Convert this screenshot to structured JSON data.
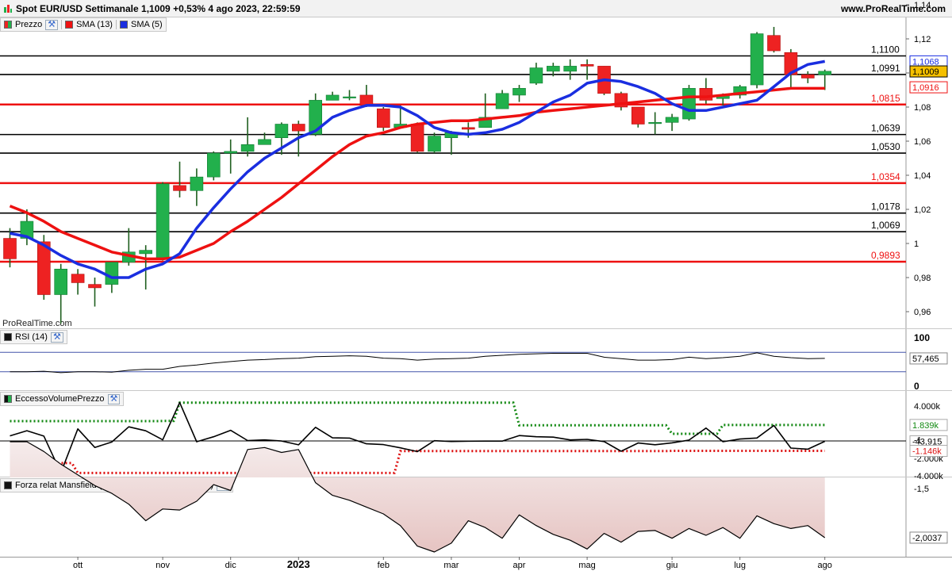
{
  "header": {
    "title": "Spot EUR/USD Settimanale 1,1009 +0,53% 4 ago 2023, 22:59:59",
    "site": "www.ProRealTime.com",
    "watermark": "ProRealTime.com"
  },
  "legend": {
    "price": "Prezzo",
    "sma13": "SMA (13)",
    "sma5": "SMA (5)",
    "rsi": "RSI (14)",
    "pve": "EccessoVolumePrezzo",
    "mansfield": "Forza relat Mansfield (FTSE MIB40 Index) (200 10)"
  },
  "colors": {
    "up": "#22b04c",
    "down": "#ee2222",
    "sma13": "#ee1111",
    "sma5": "#1a2ee0",
    "support": "#000000",
    "key_level": "#ee1111",
    "band_upper": "#118811",
    "band_lower": "#dd1111",
    "mansfield_fill": "#e6c4c2"
  },
  "chart_data": [
    {
      "type": "candlestick",
      "panel": "price",
      "title": "Spot EUR/USD Settimanale",
      "ylim": [
        0.94,
        1.145
      ],
      "y_ticks": [
        {
          "v": 0.96,
          "label": "0,96"
        },
        {
          "v": 0.98,
          "label": "0,98"
        },
        {
          "v": 1.0,
          "label": "1"
        },
        {
          "v": 1.02,
          "label": "1,02"
        },
        {
          "v": 1.04,
          "label": "1,04"
        },
        {
          "v": 1.06,
          "label": "1,06"
        },
        {
          "v": 1.08,
          "label": "1,08"
        },
        {
          "v": 1.1,
          "label": "1,10"
        },
        {
          "v": 1.12,
          "label": "1,12"
        },
        {
          "v": 1.14,
          "label": "1,14"
        }
      ],
      "x_labels": [
        {
          "i": 4,
          "label": "ott"
        },
        {
          "i": 9,
          "label": "nov"
        },
        {
          "i": 13,
          "label": "dic"
        },
        {
          "i": 17,
          "label": "2023"
        },
        {
          "i": 22,
          "label": "feb"
        },
        {
          "i": 26,
          "label": "mar"
        },
        {
          "i": 30,
          "label": "apr"
        },
        {
          "i": 34,
          "label": "mag"
        },
        {
          "i": 39,
          "label": "giu"
        },
        {
          "i": 43,
          "label": "lug"
        },
        {
          "i": 48,
          "label": "ago"
        }
      ],
      "candles": [
        [
          1.003,
          0.991,
          1.009,
          0.986
        ],
        [
          1.003,
          1.013,
          1.02,
          0.999
        ],
        [
          1.001,
          0.97,
          1.005,
          0.967
        ],
        [
          0.97,
          0.985,
          0.988,
          0.953
        ],
        [
          0.982,
          0.977,
          0.985,
          0.97
        ],
        [
          0.976,
          0.974,
          0.98,
          0.963
        ],
        [
          0.976,
          0.989,
          0.989,
          0.971
        ],
        [
          0.989,
          0.995,
          1.009,
          0.987
        ],
        [
          0.994,
          0.996,
          0.999,
          0.973
        ],
        [
          0.991,
          1.035,
          1.036,
          0.99
        ],
        [
          1.034,
          1.031,
          1.048,
          1.027
        ],
        [
          1.031,
          1.039,
          1.044,
          1.022
        ],
        [
          1.039,
          1.053,
          1.054,
          1.037
        ],
        [
          1.053,
          1.054,
          1.061,
          1.041
        ],
        [
          1.054,
          1.058,
          1.074,
          1.051
        ],
        [
          1.058,
          1.061,
          1.065,
          1.058
        ],
        [
          1.062,
          1.07,
          1.071,
          1.052
        ],
        [
          1.07,
          1.066,
          1.072,
          1.051
        ],
        [
          1.064,
          1.084,
          1.088,
          1.063
        ],
        [
          1.084,
          1.087,
          1.089,
          1.084
        ],
        [
          1.086,
          1.086,
          1.09,
          1.084
        ],
        [
          1.087,
          1.081,
          1.093,
          1.08
        ],
        [
          1.079,
          1.068,
          1.08,
          1.066
        ],
        [
          1.068,
          1.07,
          1.081,
          1.068
        ],
        [
          1.07,
          1.054,
          1.071,
          1.053
        ],
        [
          1.054,
          1.063,
          1.065,
          1.053
        ],
        [
          1.062,
          1.065,
          1.066,
          1.052
        ],
        [
          1.068,
          1.067,
          1.071,
          1.062
        ],
        [
          1.068,
          1.074,
          1.088,
          1.068
        ],
        [
          1.079,
          1.088,
          1.09,
          1.079
        ],
        [
          1.087,
          1.091,
          1.093,
          1.083
        ],
        [
          1.094,
          1.103,
          1.106,
          1.093
        ],
        [
          1.101,
          1.104,
          1.106,
          1.098
        ],
        [
          1.101,
          1.104,
          1.108,
          1.096
        ],
        [
          1.105,
          1.104,
          1.108,
          1.096
        ],
        [
          1.104,
          1.088,
          1.104,
          1.087
        ],
        [
          1.088,
          1.08,
          1.089,
          1.078
        ],
        [
          1.08,
          1.07,
          1.08,
          1.068
        ],
        [
          1.071,
          1.071,
          1.077,
          1.064
        ],
        [
          1.071,
          1.074,
          1.076,
          1.066
        ],
        [
          1.073,
          1.091,
          1.093,
          1.072
        ],
        [
          1.091,
          1.084,
          1.097,
          1.082
        ],
        [
          1.085,
          1.087,
          1.088,
          1.081
        ],
        [
          1.087,
          1.092,
          1.093,
          1.085
        ],
        [
          1.093,
          1.123,
          1.124,
          1.091
        ],
        [
          1.122,
          1.113,
          1.127,
          1.112
        ],
        [
          1.112,
          1.099,
          1.114,
          1.091
        ],
        [
          1.099,
          1.097,
          1.101,
          1.094
        ],
        [
          1.099,
          1.101,
          1.102,
          1.09
        ]
      ],
      "sma13": [
        1.022,
        1.018,
        1.013,
        1.007,
        1.003,
        0.999,
        0.995,
        0.993,
        0.991,
        0.991,
        0.992,
        0.996,
        1.0,
        1.007,
        1.013,
        1.02,
        1.027,
        1.035,
        1.043,
        1.051,
        1.058,
        1.063,
        1.065,
        1.068,
        1.07,
        1.071,
        1.072,
        1.072,
        1.073,
        1.074,
        1.075,
        1.077,
        1.078,
        1.079,
        1.08,
        1.081,
        1.082,
        1.083,
        1.084,
        1.085,
        1.086,
        1.086,
        1.087,
        1.088,
        1.089,
        1.09,
        1.091,
        1.091,
        1.091
      ],
      "sma5": [
        1.006,
        1.004,
        0.999,
        0.993,
        0.988,
        0.985,
        0.98,
        0.98,
        0.985,
        0.988,
        0.994,
        1.009,
        1.021,
        1.032,
        1.042,
        1.05,
        1.056,
        1.062,
        1.066,
        1.074,
        1.078,
        1.081,
        1.081,
        1.08,
        1.075,
        1.068,
        1.065,
        1.064,
        1.065,
        1.067,
        1.071,
        1.077,
        1.083,
        1.087,
        1.094,
        1.096,
        1.095,
        1.092,
        1.088,
        1.082,
        1.078,
        1.078,
        1.08,
        1.082,
        1.084,
        1.092,
        1.1,
        1.105,
        1.1068
      ],
      "levels": [
        {
          "v": 1.11,
          "label": "1,1100",
          "kind": "support"
        },
        {
          "v": 1.0991,
          "label": "1,0991",
          "kind": "support"
        },
        {
          "v": 1.0815,
          "label": "1,0815",
          "kind": "key"
        },
        {
          "v": 1.0639,
          "label": "1,0639",
          "kind": "support"
        },
        {
          "v": 1.053,
          "label": "1,0530",
          "kind": "support"
        },
        {
          "v": 1.0354,
          "label": "1,0354",
          "kind": "key"
        },
        {
          "v": 1.0178,
          "label": "1,0178",
          "kind": "support"
        },
        {
          "v": 1.0069,
          "label": "1,0069",
          "kind": "support"
        },
        {
          "v": 0.9893,
          "label": "0,9893",
          "kind": "key"
        }
      ],
      "badges": [
        {
          "v": 1.1068,
          "label": "1,1068",
          "series": "sma5"
        },
        {
          "v": 1.1009,
          "label": "1,1009",
          "series": "price"
        },
        {
          "v": 1.0916,
          "label": "1,0916",
          "series": "sma13"
        }
      ]
    },
    {
      "type": "line",
      "panel": "rsi",
      "name": "RSI (14)",
      "ylim": [
        0,
        100
      ],
      "y_ticks": [
        {
          "v": 100,
          "label": "100"
        },
        {
          "v": 0,
          "label": "0"
        }
      ],
      "bands": [
        70,
        30
      ],
      "values": [
        30,
        30,
        31,
        28,
        30,
        30,
        29,
        33,
        35,
        35,
        41,
        44,
        48,
        51,
        54,
        55,
        57,
        58,
        61,
        62,
        63,
        62,
        58,
        57,
        54,
        56,
        57,
        58,
        62,
        64,
        66,
        67,
        68,
        68,
        68,
        60,
        57,
        54,
        54,
        55,
        60,
        57,
        59,
        62,
        69,
        62,
        59,
        57,
        57.465
      ],
      "badge": {
        "v": 57.465,
        "label": "57,465"
      }
    },
    {
      "type": "line",
      "panel": "pve",
      "name": "EccessoVolumePrezzo",
      "ylim": [
        -4500,
        5200
      ],
      "y_ticks": [
        {
          "v": 4000,
          "label": "4.000k"
        },
        {
          "v": 2000,
          "label": "2.000k"
        },
        {
          "v": 0,
          "label": "0"
        },
        {
          "v": -2000,
          "label": "-2.000k"
        },
        {
          "v": -4000,
          "label": "-4.000k"
        }
      ],
      "values": [
        580,
        1180,
        560,
        -3670,
        1390,
        -750,
        -130,
        1630,
        1170,
        130,
        4420,
        -90,
        480,
        1220,
        50,
        120,
        -10,
        -450,
        1570,
        360,
        330,
        -330,
        -420,
        -790,
        -1220,
        30,
        -60,
        -30,
        -20,
        -20,
        620,
        480,
        440,
        120,
        180,
        -70,
        -1190,
        -240,
        -440,
        -220,
        100,
        1480,
        -90,
        220,
        340,
        1780,
        -820,
        -950,
        -43.915
      ],
      "upper_band": [
        2280,
        2280,
        2280,
        2280,
        2280,
        2280,
        2280,
        2280,
        2280,
        2300,
        4400,
        4400,
        4400,
        4400,
        4400,
        4400,
        4400,
        4400,
        4400,
        4400,
        4400,
        4400,
        4400,
        4400,
        4400,
        4400,
        4400,
        4400,
        4400,
        4400,
        1800,
        1800,
        1800,
        1800,
        1800,
        1800,
        1800,
        1800,
        1800,
        820,
        820,
        820,
        1839,
        1839,
        1839,
        1839,
        1839,
        1839,
        1839
      ],
      "lower_band": [
        -2550,
        -2550,
        -2550,
        -2550,
        -3690,
        -3690,
        -3690,
        -3690,
        -3690,
        -3690,
        -3690,
        -3690,
        -3690,
        -3690,
        -3690,
        -3690,
        -3690,
        -3690,
        -3690,
        -3690,
        -3690,
        -3690,
        -3690,
        -1170,
        -1170,
        -1170,
        -1170,
        -1170,
        -1170,
        -1170,
        -1170,
        -1170,
        -1170,
        -1170,
        -1170,
        -1170,
        -1170,
        -1170,
        -1170,
        -1146,
        -1146,
        -1146,
        -1146,
        -1146,
        -1146,
        -1146,
        -1146,
        -1146,
        -1146
      ],
      "badges": [
        {
          "v": 1839,
          "label": "1.839k",
          "kind": "upper"
        },
        {
          "v": -43.915,
          "label": "-43,915",
          "kind": "line"
        },
        {
          "v": -1146,
          "label": "-1.146k",
          "kind": "lower"
        }
      ]
    },
    {
      "type": "area",
      "panel": "mansfield",
      "name": "Forza relat Mansfield (FTSE MIB40 Index) (200 10)",
      "ylim": [
        -2.2,
        -0.92
      ],
      "y_ticks": [
        {
          "v": -1,
          "label": "-1"
        },
        {
          "v": -1.5,
          "label": "-1,5"
        },
        {
          "v": -2,
          "label": "-2"
        }
      ],
      "values": [
        -1.02,
        -1.02,
        -1.12,
        -1.25,
        -1.36,
        -1.47,
        -1.55,
        -1.66,
        -1.83,
        -1.71,
        -1.72,
        -1.63,
        -1.46,
        -1.52,
        -1.1,
        -1.08,
        -1.13,
        -1.1,
        -1.44,
        -1.57,
        -1.62,
        -1.69,
        -1.76,
        -1.88,
        -2.09,
        -2.15,
        -2.06,
        -1.83,
        -1.9,
        -2.01,
        -1.77,
        -1.88,
        -1.97,
        -2.03,
        -2.12,
        -1.96,
        -2.05,
        -1.94,
        -1.93,
        -2.01,
        -1.91,
        -1.98,
        -1.9,
        -2.01,
        -1.78,
        -1.86,
        -1.91,
        -1.88,
        -2.0037
      ],
      "badge": {
        "v": -2.0037,
        "label": "-2,0037"
      }
    }
  ]
}
